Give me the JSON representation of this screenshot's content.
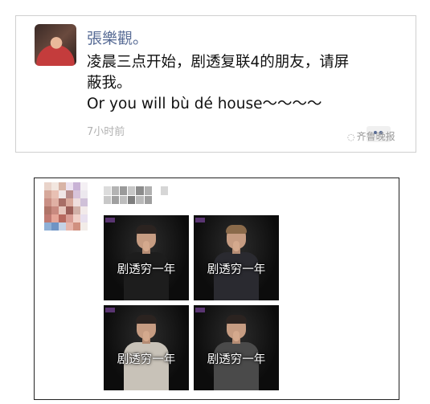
{
  "post1": {
    "author": "張樂觀。",
    "text_line1": "凌晨三点开始，剧透复联4的朋友，请屏",
    "text_line2": "蔽我。",
    "text_line3": "Or you will bù dé house～～～～",
    "time": "7小时前",
    "watermark": "齐鲁晚报"
  },
  "post2": {
    "photos": [
      {
        "caption": "剧透穷一年",
        "shirt_color": "#1d1d1d"
      },
      {
        "caption": "剧透穷一年",
        "shirt_color": "#2a2a30"
      },
      {
        "caption": "剧透穷一年",
        "shirt_color": "#c8c2b8"
      },
      {
        "caption": "剧透穷一年",
        "shirt_color": "#4a4a4a"
      }
    ]
  },
  "colors": {
    "author_link": "#576b95",
    "timestamp": "#b2b2b2",
    "border": "#cfcfcf"
  }
}
